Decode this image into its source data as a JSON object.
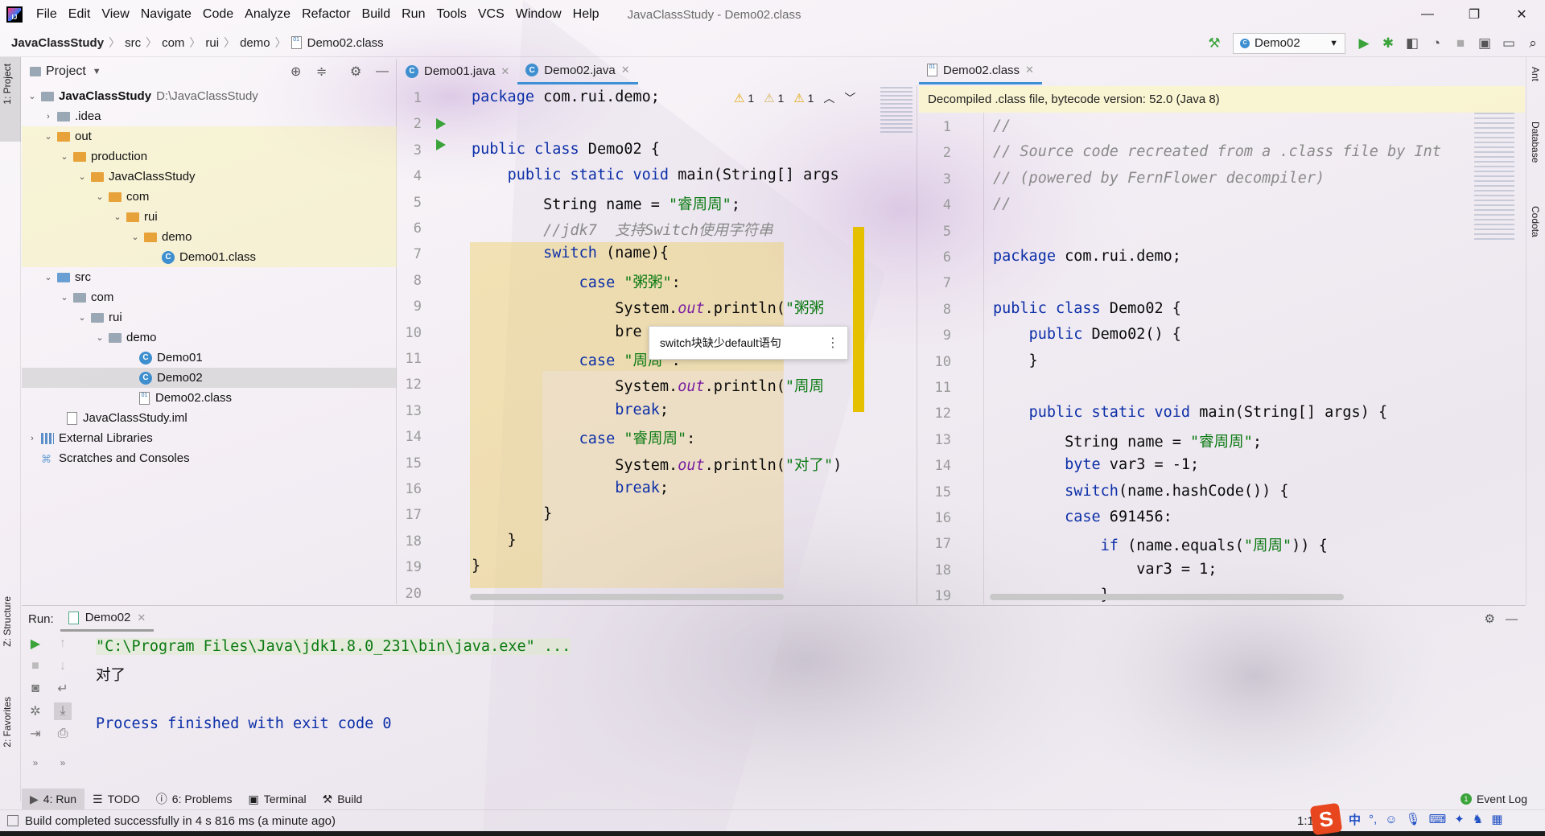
{
  "window": {
    "title": "JavaClassStudy - Demo02.class",
    "menu": [
      "File",
      "Edit",
      "View",
      "Navigate",
      "Code",
      "Analyze",
      "Refactor",
      "Build",
      "Run",
      "Tools",
      "VCS",
      "Window",
      "Help"
    ]
  },
  "breadcrumb": [
    "JavaClassStudy",
    "src",
    "com",
    "rui",
    "demo",
    "Demo02.class"
  ],
  "toolbar": {
    "run_config": "Demo02"
  },
  "left_stripe": {
    "project": "1: Project",
    "structure": "Z: Structure",
    "favorites": "2: Favorites"
  },
  "right_stripe": {
    "ant": "Ant",
    "database": "Database",
    "codota": "Codota"
  },
  "project_panel": {
    "title": "Project",
    "tree": [
      {
        "label": "JavaClassStudy",
        "extra": "D:\\JavaClassStudy"
      },
      {
        "label": ".idea"
      },
      {
        "label": "out"
      },
      {
        "label": "production"
      },
      {
        "label": "JavaClassStudy"
      },
      {
        "label": "com"
      },
      {
        "label": "rui"
      },
      {
        "label": "demo"
      },
      {
        "label": "Demo01.class"
      },
      {
        "label": "src"
      },
      {
        "label": "com"
      },
      {
        "label": "rui"
      },
      {
        "label": "demo"
      },
      {
        "label": "Demo01"
      },
      {
        "label": "Demo02"
      },
      {
        "label": "Demo02.class"
      },
      {
        "label": "JavaClassStudy.iml"
      },
      {
        "label": "External Libraries"
      },
      {
        "label": "Scratches and Consoles"
      }
    ]
  },
  "editor_left": {
    "tabs": [
      "Demo01.java",
      "Demo02.java"
    ],
    "warnings": [
      "1",
      "1",
      "1"
    ],
    "line_numbers": [
      "1",
      "2",
      "3",
      "4",
      "5",
      "6",
      "7",
      "8",
      "9",
      "10",
      "11",
      "12",
      "13",
      "14",
      "15",
      "16",
      "17",
      "18",
      "19",
      "20"
    ],
    "lines": [
      "package com.rui.demo;",
      "",
      "public class Demo02 {",
      "    public static void main(String[] args",
      "        String name = \"睿周周\";",
      "        //jdk7  支持Switch使用字符串",
      "        switch (name){",
      "            case \"粥粥\":",
      "                System.out.println(\"粥粥",
      "                bre",
      "            case \"周周\":",
      "                System.out.println(\"周周",
      "                break;",
      "            case \"睿周周\":",
      "                System.out.println(\"对了\")",
      "                break;",
      "        }",
      "    }",
      "}",
      ""
    ],
    "tooltip": "switch块缺少default语句"
  },
  "editor_right": {
    "tab": "Demo02.class",
    "banner": "Decompiled .class file, bytecode version: 52.0 (Java 8)",
    "line_numbers": [
      "1",
      "2",
      "3",
      "4",
      "5",
      "6",
      "7",
      "8",
      "9",
      "10",
      "11",
      "12",
      "13",
      "14",
      "15",
      "16",
      "17",
      "18",
      "19"
    ],
    "lines": [
      "//",
      "// Source code recreated from a .class file by Int",
      "// (powered by FernFlower decompiler)",
      "//",
      "",
      "package com.rui.demo;",
      "",
      "public class Demo02 {",
      "    public Demo02() {",
      "    }",
      "",
      "    public static void main(String[] args) {",
      "        String name = \"睿周周\";",
      "        byte var3 = -1;",
      "        switch(name.hashCode()) {",
      "        case 691456:",
      "            if (name.equals(\"周周\")) {",
      "                var3 = 1;",
      "            }"
    ]
  },
  "run_panel": {
    "label": "Run:",
    "tab": "Demo02",
    "console": [
      "\"C:\\Program Files\\Java\\jdk1.8.0_231\\bin\\java.exe\" ...",
      "对了",
      "",
      "Process finished with exit code 0"
    ]
  },
  "bottom_tools": {
    "run": "4: Run",
    "todo": "TODO",
    "problems": "6: Problems",
    "terminal": "Terminal",
    "build": "Build",
    "event_log": "Event Log",
    "event_count": "1"
  },
  "status": {
    "message": "Build completed successfully in 4 s 816 ms (a minute ago)",
    "position": "1:1"
  },
  "ime": {
    "logo": "S",
    "lang": "中"
  },
  "colors": {
    "accent": "#3d8fd6",
    "keyword": "#0c2fa8",
    "string": "#0b7a12",
    "run_green": "#3aa33a",
    "warning": "#e2a400"
  }
}
